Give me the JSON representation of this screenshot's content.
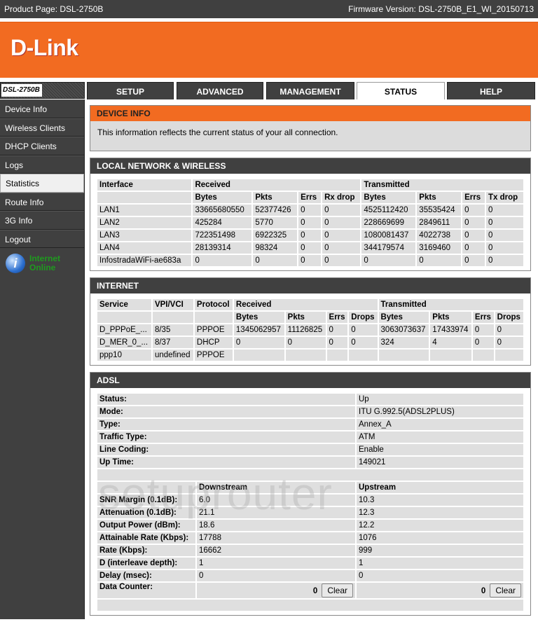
{
  "topbar": {
    "product": "Product Page: DSL-2750B",
    "firmware": "Firmware Version: DSL-2750B_E1_WI_20150713"
  },
  "logo": "D-Link",
  "model": "DSL-2750B",
  "tabs": [
    {
      "label": "SETUP"
    },
    {
      "label": "ADVANCED"
    },
    {
      "label": "MANAGEMENT"
    },
    {
      "label": "STATUS",
      "active": true
    },
    {
      "label": "HELP"
    }
  ],
  "sidebar": {
    "items": [
      "Device Info",
      "Wireless Clients",
      "DHCP Clients",
      "Logs",
      "Statistics",
      "Route Info",
      "3G Info",
      "Logout"
    ],
    "active": "Statistics",
    "status_line1": "Internet",
    "status_line2": "Online"
  },
  "device_info": {
    "title": "DEVICE INFO",
    "text": "This information reflects the current status of your all connection."
  },
  "local": {
    "title": "LOCAL NETWORK & WIRELESS",
    "head1": [
      "Interface",
      "Received",
      "Transmitted"
    ],
    "head2": [
      "",
      "Bytes",
      "Pkts",
      "Errs",
      "Rx drop",
      "Bytes",
      "Pkts",
      "Errs",
      "Tx drop"
    ],
    "rows": [
      [
        "LAN1",
        "33665680550",
        "52377426",
        "0",
        "0",
        "4525112420",
        "35535424",
        "0",
        "0"
      ],
      [
        "LAN2",
        "425284",
        "5770",
        "0",
        "0",
        "228669699",
        "2849611",
        "0",
        "0"
      ],
      [
        "LAN3",
        "722351498",
        "6922325",
        "0",
        "0",
        "1080081437",
        "4022738",
        "0",
        "0"
      ],
      [
        "LAN4",
        "28139314",
        "98324",
        "0",
        "0",
        "344179574",
        "3169460",
        "0",
        "0"
      ],
      [
        "InfostradaWiFi-ae683a",
        "0",
        "0",
        "0",
        "0",
        "0",
        "0",
        "0",
        "0"
      ]
    ]
  },
  "internet": {
    "title": "INTERNET",
    "head1": [
      "Service",
      "VPI/VCI",
      "Protocol",
      "Received",
      "Transmitted"
    ],
    "head2": [
      "",
      "",
      "",
      "Bytes",
      "Pkts",
      "Errs",
      "Drops",
      "Bytes",
      "Pkts",
      "Errs",
      "Drops"
    ],
    "rows": [
      [
        "D_PPPoE_...",
        "8/35",
        "PPPOE",
        "1345062957",
        "11126825",
        "0",
        "0",
        "3063073637",
        "17433974",
        "0",
        "0"
      ],
      [
        "D_MER_0_...",
        "8/37",
        "DHCP",
        "0",
        "0",
        "0",
        "0",
        "324",
        "4",
        "0",
        "0"
      ],
      [
        "ppp10",
        "undefined",
        "PPPOE",
        "",
        "",
        "",
        "",
        "",
        "",
        "",
        ""
      ]
    ]
  },
  "adsl": {
    "title": "ADSL",
    "info": [
      [
        "Status:",
        "Up"
      ],
      [
        "Mode:",
        "ITU G.992.5(ADSL2PLUS)"
      ],
      [
        "Type:",
        "Annex_A"
      ],
      [
        "Traffic Type:",
        "ATM"
      ],
      [
        "Line Coding:",
        "Enable"
      ],
      [
        "Up Time:",
        "149021"
      ]
    ],
    "stream_head": [
      "",
      "Downstream",
      "Upstream"
    ],
    "stats": [
      [
        "SNR Margin (0.1dB):",
        "6.0",
        "10.3"
      ],
      [
        "Attenuation (0.1dB):",
        "21.1",
        "12.3"
      ],
      [
        "Output Power (dBm):",
        "18.6",
        "12.2"
      ],
      [
        "Attainable Rate (Kbps):",
        "17788",
        "1076"
      ],
      [
        "Rate (Kbps):",
        "16662",
        "999"
      ],
      [
        "D (interleave depth):",
        "1",
        "1"
      ],
      [
        "Delay (msec):",
        "0",
        "0"
      ]
    ],
    "counter": {
      "label": "Data Counter:",
      "down": "0",
      "up": "0",
      "clear": "Clear"
    }
  },
  "watermark": "setuprouter"
}
